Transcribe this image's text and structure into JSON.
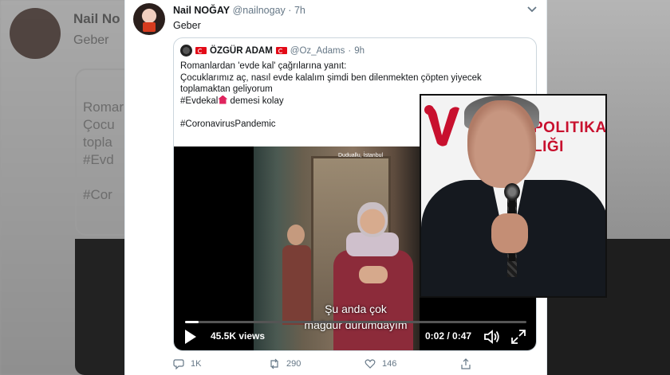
{
  "background": {
    "name": "Nail No",
    "text": "Geber",
    "lines": [
      "Romar",
      "Çocu",
      "topla",
      "#Evd",
      "",
      "#Cor"
    ]
  },
  "tweet": {
    "author_name": "Nail NOĞAY",
    "author_handle": "@nailnogay",
    "separator": "·",
    "time": "7h",
    "text": "Geber",
    "menu_icon": "chevron-down-icon",
    "quote": {
      "author_name": "ÖZGÜR ADAM",
      "author_handle": "@Oz_Adams",
      "time": "9h",
      "lines": [
        "Romanlardan 'evde kal' çağrılarına yanıt:",
        "Çocuklarımız aç, nasıl evde kalalım şimdi ben dilenmekten çöpten yiyecek",
        "toplamaktan geliyorum"
      ],
      "hashtag_evdekal": "#Evdekal",
      "hashtag_suffix": " demesi kolay",
      "hashtag_pandemic": "#CoronavirusPandemic"
    },
    "video": {
      "location": "Duduallu, İstanbul",
      "subtitle_1": "Şu anda çok",
      "subtitle_2": "mağdur durumdayım",
      "views": "45.5K views",
      "current_time": "0:02",
      "duration": "0:47",
      "time_display": "0:02 / 0:47",
      "progress_fraction": 0.04
    },
    "actions": {
      "replies": "1K",
      "retweets": "290",
      "likes": "146"
    }
  },
  "overlay": {
    "sign_line_1": "POLITIKA",
    "sign_line_2": "LIĞI"
  },
  "colors": {
    "accent_red": "#c8102e",
    "twitter_gray": "#657786",
    "like_pink": "#e0245e"
  }
}
